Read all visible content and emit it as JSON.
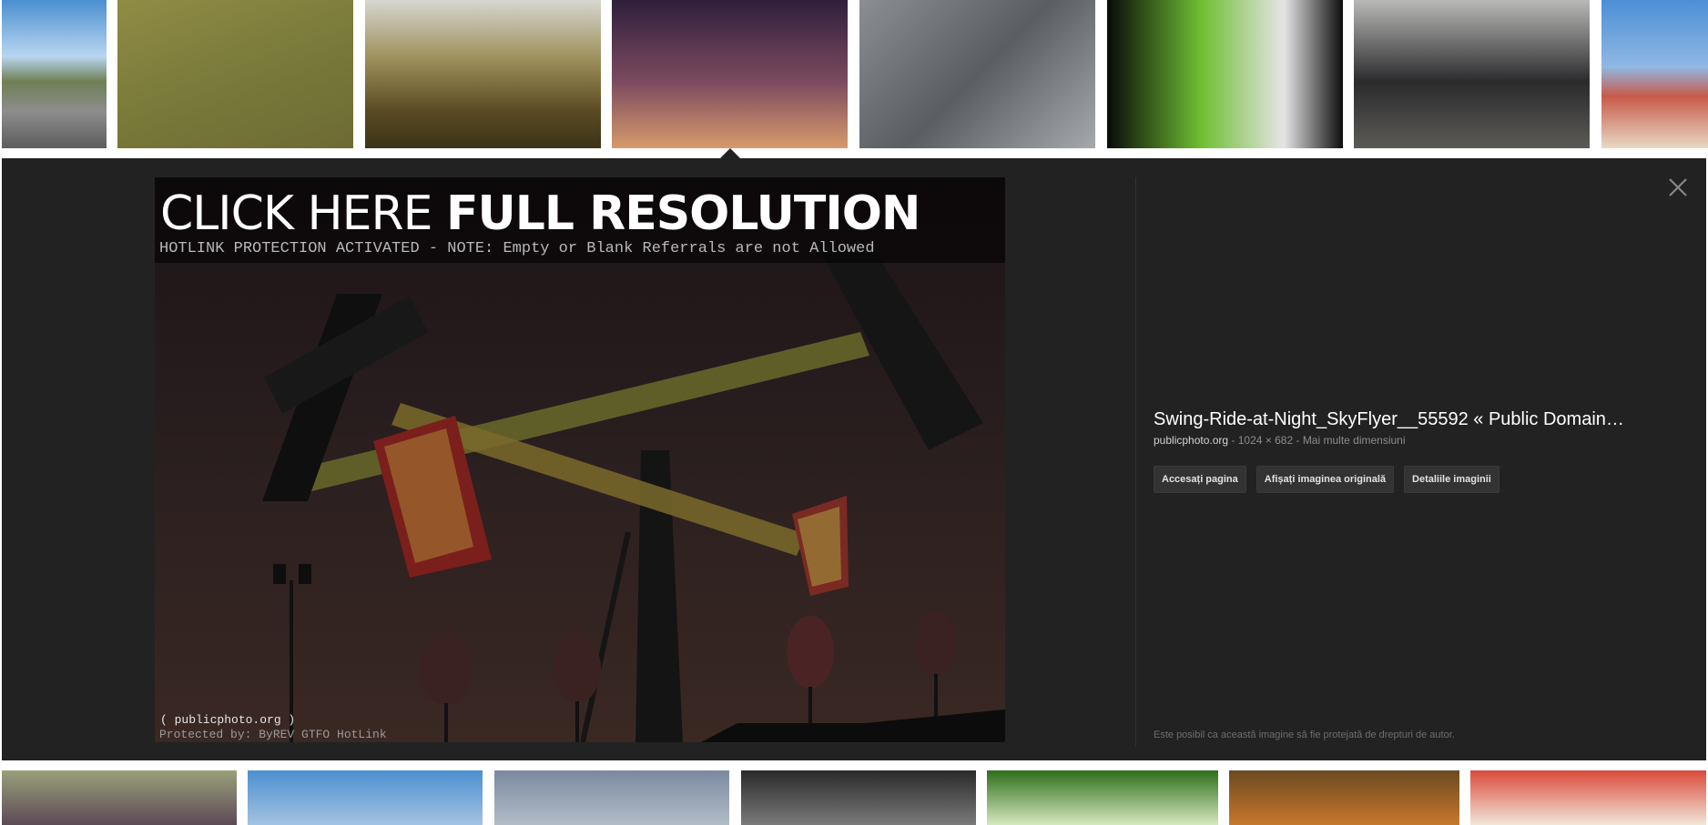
{
  "top_thumbnails": [
    {
      "label": "road-thumbnail",
      "bg": "linear-gradient(180deg,#4a8fd0 0%,#b9d6f0 38%,#6f7f55 55%,#8d8d8d 75%,#5d5d5d 100%)"
    },
    {
      "label": "field-shadow-thumbnail",
      "bg": "linear-gradient(160deg,#8f8c45 0%,#7a7a3a 50%,#6d6b34 100%)"
    },
    {
      "label": "autumn-trees-thumbnail",
      "bg": "linear-gradient(180deg,#d6d6cf 0%,#9d8f5a 40%,#5a4a23 75%,#3b3418 100%)"
    },
    {
      "label": "swing-ride-thumbnail",
      "bg": "linear-gradient(180deg,#2f1f3c 0%,#7c4a5f 55%,#d79a6b 100%)"
    },
    {
      "label": "pigeons-thumbnail",
      "bg": "linear-gradient(135deg,#8b8e92 0%,#5a5e62 50%,#a5a9ad 100%)"
    },
    {
      "label": "tablet-app-thumbnail",
      "bg": "linear-gradient(90deg,#0a0a0a 0%,#6fbf32 40%,#e5e5e5 75%,#0d0d0d 100%)"
    },
    {
      "label": "mercedes-thumbnail",
      "bg": "linear-gradient(180deg,#b9b9b7 0%,#2b2b2d 55%,#5c5a56 100%)"
    },
    {
      "label": "beach-thumbnail",
      "bg": "linear-gradient(180deg,#4c8fd6 0%,#8fb8e3 45%,#c85a4a 65%,#e8d9c4 100%)"
    }
  ],
  "bottom_thumbnails": [
    {
      "label": "berries-thumbnail",
      "bg": "linear-gradient(180deg,#9aa07a 0%,#5d4a57 100%)"
    },
    {
      "label": "people-beach-thumbnail",
      "bg": "linear-gradient(180deg,#4d8fd0 0%,#a3c3e2 100%)"
    },
    {
      "label": "sky-thumbnail",
      "bg": "linear-gradient(180deg,#7b8aa0 0%,#b2bcc8 100%)"
    },
    {
      "label": "mixer-thumbnail",
      "bg": "linear-gradient(180deg,#2a2a2a 0%,#7a7a7a 100%)"
    },
    {
      "label": "onions-thumbnail",
      "bg": "linear-gradient(180deg,#2e6e1a 0%,#d6e8c0 100%)"
    },
    {
      "label": "mushroom-thumbnail",
      "bg": "linear-gradient(180deg,#6b4a22 0%,#c7782b 100%)"
    },
    {
      "label": "boat-thumbnail",
      "bg": "linear-gradient(180deg,#d94a3b 0%,#f2e6d8 100%)"
    }
  ],
  "preview": {
    "hotlink_title_plain": "CLICK HERE ",
    "hotlink_title_bold": "FULL RESOLUTION",
    "hotlink_note": "HOTLINK PROTECTION ACTIVATED - NOTE: Empty or Blank Referrals are not Allowed",
    "watermark_site": "( publicphoto.org )",
    "watermark_protect": "Protected by: ByREV GTFO HotLink"
  },
  "details": {
    "title": "Swing-Ride-at-Night_SkyFlyer__55592 « Public Domain…",
    "domain": "publicphoto.org",
    "separator1": " - ",
    "dimensions": "1024 × 682",
    "separator2": " - ",
    "more_sizes": "Mai multe dimensiuni",
    "buttons": {
      "visit_page": "Accesați pagina",
      "view_original": "Afișați imaginea originală",
      "image_details": "Detaliile imaginii"
    },
    "copyright_note": "Este posibil ca această imagine să fie protejată de drepturi de autor."
  },
  "colors": {
    "panel_bg": "#222222",
    "button_bg": "#333333",
    "ride_frame": "#e2b33a",
    "ride_dark": "#141414"
  }
}
